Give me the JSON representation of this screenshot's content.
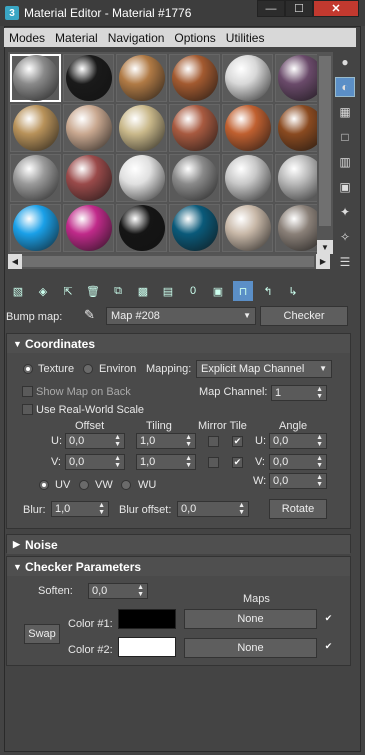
{
  "window": {
    "app_icon": "3",
    "title": "Material Editor - Material #1776",
    "minimize": "—",
    "maximize": "☐",
    "close": "✕"
  },
  "menu": [
    "Modes",
    "Material",
    "Navigation",
    "Options",
    "Utilities"
  ],
  "slots": [
    {
      "color": "#8a8a8a"
    },
    {
      "color": "#1a1a1a"
    },
    {
      "color": "#b07a45"
    },
    {
      "color": "#a35a30"
    },
    {
      "color": "#d8d8d8"
    },
    {
      "color": "#6a4a6a"
    },
    {
      "color": "#b8925a"
    },
    {
      "color": "#c9a890"
    },
    {
      "color": "#c9b88a"
    },
    {
      "color": "#a85a40"
    },
    {
      "color": "#c06030"
    },
    {
      "color": "#8a4a20"
    },
    {
      "color": "#9a9a9a"
    },
    {
      "color": "#9a4a4a"
    },
    {
      "color": "#e0e0e0"
    },
    {
      "color": "#8a8a8a"
    },
    {
      "color": "#c8c8c8"
    },
    {
      "color": "#b8b8b8"
    },
    {
      "color": "#1aa0e8"
    },
    {
      "color": "#c02a8a"
    },
    {
      "color": "#151515"
    },
    {
      "color": "#0a5a7a"
    },
    {
      "color": "#c8b8a8"
    },
    {
      "color": "#8a8078"
    }
  ],
  "bump": {
    "label": "Bump map:",
    "map_name": "Map #208",
    "type_button": "Checker"
  },
  "coordinates": {
    "title": "Coordinates",
    "texture": "Texture",
    "environ": "Environ",
    "mapping_label": "Mapping:",
    "mapping_value": "Explicit Map Channel",
    "show_map": "Show Map on Back",
    "real_world": "Use Real-World Scale",
    "map_channel_label": "Map Channel:",
    "map_channel_value": "1",
    "col_offset": "Offset",
    "col_tiling": "Tiling",
    "col_mirror": "Mirror Tile",
    "col_angle": "Angle",
    "u_label": "U:",
    "v_label": "V:",
    "w_label": "W:",
    "u_offset": "0,0",
    "v_offset": "0,0",
    "u_tiling": "1,0",
    "v_tiling": "1,0",
    "u_angle": "0,0",
    "v_angle": "0,0",
    "w_angle": "0,0",
    "uv": "UV",
    "vw": "VW",
    "wu": "WU",
    "blur_label": "Blur:",
    "blur_value": "1,0",
    "blur_offset_label": "Blur offset:",
    "blur_offset_value": "0,0",
    "rotate": "Rotate"
  },
  "noise": {
    "title": "Noise"
  },
  "checker": {
    "title": "Checker Parameters",
    "soften_label": "Soften:",
    "soften_value": "0,0",
    "maps_label": "Maps",
    "swap": "Swap",
    "color1_label": "Color #1:",
    "color1": "#000000",
    "color2_label": "Color #2:",
    "color2": "#ffffff",
    "map1": "None",
    "map2": "None"
  }
}
